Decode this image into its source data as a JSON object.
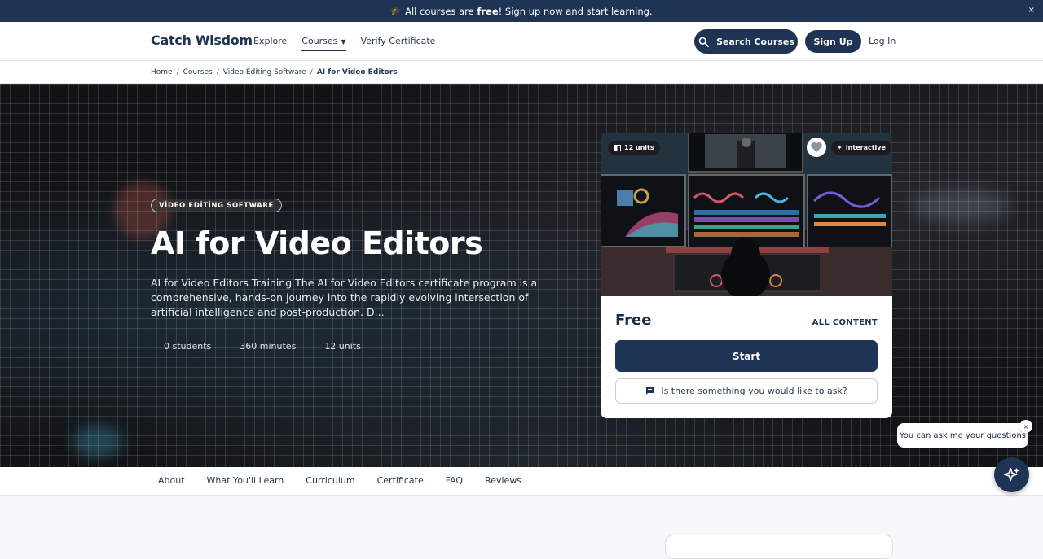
{
  "announcement": {
    "icon": "graduation-cap-icon",
    "prefix": "All courses are ",
    "free": "free",
    "suffix": "! Sign up now and start learning.",
    "close": "×"
  },
  "header": {
    "logo": "Catch Wisdom",
    "nav": [
      {
        "label": "Explore"
      },
      {
        "label": "Courses"
      },
      {
        "label": "Verify Certificate"
      }
    ],
    "search_label": "Search Courses",
    "signup_label": "Sign Up",
    "login_label": "Log In"
  },
  "breadcrumb": {
    "items": [
      "Home",
      "Courses",
      "Video Editing Software"
    ],
    "current": "AI for Video Editors",
    "separator": "/"
  },
  "hero": {
    "tag": "VİDEO EDİTİNG SOFTWARE",
    "title": "AI for Video Editors",
    "description": "AI for Video Editors Training The AI for Video Editors certificate program is a comprehensive, hands-on journey into the rapidly evolving intersection of artificial intelligence and post-production. D...",
    "stats": [
      "0 students",
      "360 minutes",
      "12 units"
    ]
  },
  "card": {
    "units_chip": "12 units",
    "interactive_chip": "Interactive",
    "price": "Free",
    "access": "ALL CONTENT",
    "start_label": "Start",
    "ask_label": "Is there something you would like to ask?"
  },
  "chat": {
    "bubble": "You can ask me your questions",
    "close": "×"
  },
  "tabs": [
    "About",
    "What You'll Learn",
    "Curriculum",
    "Certificate",
    "FAQ",
    "Reviews"
  ],
  "colors": {
    "primary": "#1f3455",
    "hero_bg": "#111315"
  }
}
